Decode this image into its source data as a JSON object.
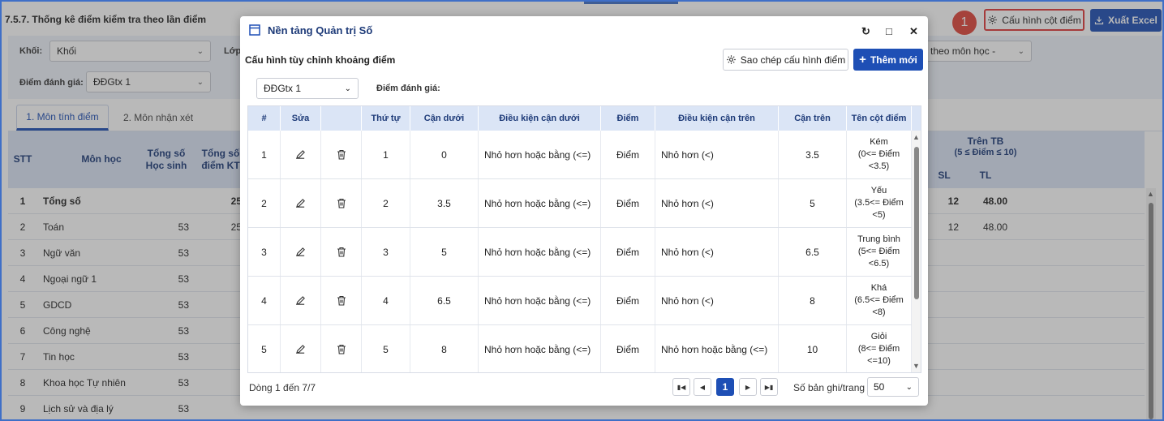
{
  "page": {
    "title": "7.5.7. Thống kê điểm kiểm tra theo lần điểm",
    "config_button": "Cấu hình cột điểm",
    "step_badge": "1",
    "excel_button": "Xuất Excel"
  },
  "filters": {
    "khoi_label": "Khối:",
    "khoi_value": "Khối",
    "lop_label": "Lớp:",
    "diem_label": "Điểm đánh giá:",
    "diem_value": "ĐĐGtx 1",
    "report_value": "g kê theo môn học -"
  },
  "tabs": [
    "1. Môn tính điểm",
    "2. Môn nhận xét"
  ],
  "bg_table": {
    "headers": {
      "stt": "STT",
      "mon": "Môn học",
      "tong_hs_1": "Tổng số",
      "tong_hs_2": "Học sinh",
      "tong_kt_1": "Tổng số",
      "tong_kt_2": "điểm KT",
      "tren_tb_1": "Trên TB",
      "tren_tb_2": "(5 ≤ Điểm ≤ 10)",
      "sl": "SL",
      "tl": "TL"
    },
    "rows": [
      {
        "stt": "1",
        "mon": "Tổng số",
        "hs": "",
        "kt": "25",
        "sl": "12",
        "tl": "48.00"
      },
      {
        "stt": "2",
        "mon": "Toán",
        "hs": "53",
        "kt": "25",
        "sl": "12",
        "tl": "48.00"
      },
      {
        "stt": "3",
        "mon": "Ngữ văn",
        "hs": "53",
        "kt": "",
        "sl": "",
        "tl": ""
      },
      {
        "stt": "4",
        "mon": "Ngoại ngữ 1",
        "hs": "53",
        "kt": "",
        "sl": "",
        "tl": ""
      },
      {
        "stt": "5",
        "mon": "GDCD",
        "hs": "53",
        "kt": "",
        "sl": "",
        "tl": ""
      },
      {
        "stt": "6",
        "mon": "Công nghệ",
        "hs": "53",
        "kt": "",
        "sl": "",
        "tl": ""
      },
      {
        "stt": "7",
        "mon": "Tin học",
        "hs": "53",
        "kt": "",
        "sl": "",
        "tl": ""
      },
      {
        "stt": "8",
        "mon": "Khoa học Tự nhiên",
        "hs": "53",
        "kt": "",
        "sl": "",
        "tl": ""
      },
      {
        "stt": "9",
        "mon": "Lịch sử và địa lý",
        "hs": "53",
        "kt": "",
        "sl": "",
        "tl": ""
      }
    ]
  },
  "modal": {
    "title": "Nền tảng Quản trị Số",
    "subtitle": "Cấu hình tùy chỉnh khoảng điểm",
    "copy_button": "Sao chép cấu hình điểm",
    "add_button": "Thêm mới",
    "select_value": "ĐĐGtx 1",
    "diem_label": "Điểm đánh giá:",
    "columns": [
      "#",
      "Sửa",
      "",
      "Thứ tự",
      "Cận dưới",
      "Điều kiện cận dưới",
      "Điểm",
      "Điều kiện cận trên",
      "Cận trên",
      "Tên cột điểm"
    ],
    "rows": [
      {
        "idx": "1",
        "order": "1",
        "lower": "0",
        "lower_cond": "Nhỏ hơn hoặc bằng (<=)",
        "diem": "Điểm",
        "upper_cond": "Nhỏ hơn (<)",
        "upper": "3.5",
        "name1": "Kém",
        "name2": "(0<= Điểm",
        "name3": "<3.5)"
      },
      {
        "idx": "2",
        "order": "2",
        "lower": "3.5",
        "lower_cond": "Nhỏ hơn hoặc bằng (<=)",
        "diem": "Điểm",
        "upper_cond": "Nhỏ hơn (<)",
        "upper": "5",
        "name1": "Yếu",
        "name2": "(3.5<= Điểm",
        "name3": "<5)"
      },
      {
        "idx": "3",
        "order": "3",
        "lower": "5",
        "lower_cond": "Nhỏ hơn hoặc bằng (<=)",
        "diem": "Điểm",
        "upper_cond": "Nhỏ hơn (<)",
        "upper": "6.5",
        "name1": "Trung bình",
        "name2": "(5<= Điểm",
        "name3": "<6.5)"
      },
      {
        "idx": "4",
        "order": "4",
        "lower": "6.5",
        "lower_cond": "Nhỏ hơn hoặc bằng (<=)",
        "diem": "Điểm",
        "upper_cond": "Nhỏ hơn (<)",
        "upper": "8",
        "name1": "Khá",
        "name2": "(6.5<= Điểm",
        "name3": "<8)"
      },
      {
        "idx": "5",
        "order": "5",
        "lower": "8",
        "lower_cond": "Nhỏ hơn hoặc bằng (<=)",
        "diem": "Điểm",
        "upper_cond": "Nhỏ hơn hoặc bằng (<=)",
        "upper": "10",
        "name1": "Giỏi",
        "name2": "(8<= Điểm",
        "name3": "<=10)"
      }
    ],
    "footer_info": "Dòng 1 đến 7/7",
    "current_page": "1",
    "per_page_label": "Số bản ghi/trang",
    "per_page_value": "50"
  },
  "colors": {
    "primary": "#1e4fb5",
    "badge": "#e0453a",
    "header_bg": "#dbe5f6"
  }
}
